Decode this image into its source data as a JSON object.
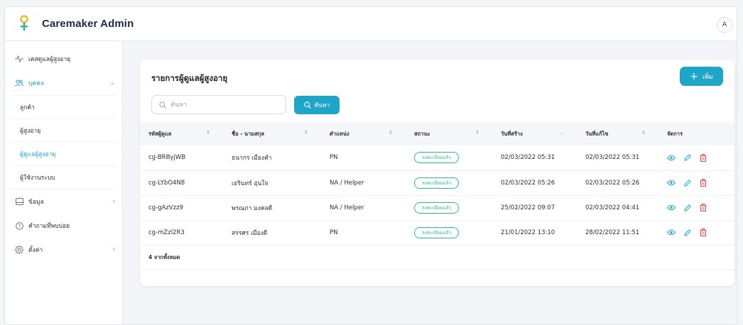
{
  "app": {
    "brand": "Caremaker Admin",
    "avatar_initial": "A",
    "accent": "#1ea5c8",
    "danger": "#e5484d",
    "success": "#2bbf8a"
  },
  "sidebar": {
    "items": [
      {
        "label": "เคสดูแลผู้สูงอายุ",
        "icon": "activity-icon"
      },
      {
        "label": "บุคคล",
        "icon": "users-icon",
        "expanded": true,
        "active": true
      },
      {
        "label": "ข้อมูล",
        "icon": "database-icon"
      },
      {
        "label": "คำถามที่พบบ่อย",
        "icon": "help-icon"
      },
      {
        "label": "ตั้งค่า",
        "icon": "settings-icon"
      }
    ],
    "subitems": [
      {
        "label": "ลูกค้า"
      },
      {
        "label": "ผู้สูงอายุ"
      },
      {
        "label": "ผู้ดูแลผู้สูงอายุ",
        "active": true
      },
      {
        "label": "ผู้ใช้งานระบบ"
      }
    ]
  },
  "main": {
    "title": "รายการผู้ดูแลผู้สูงอายุ",
    "add_label": "เพิ่ม",
    "search_placeholder": "ค้นหา",
    "search_button": "ค้นหา",
    "columns": [
      "รหัสผู้ดูแล",
      "ชื่อ - นามสกุล",
      "ตำแหน่ง",
      "สถานะ",
      "วันที่สร้าง",
      "วันที่แก้ไข",
      "จัดการ"
    ],
    "rows": [
      {
        "id": "cg-BRByjWB",
        "name": "ธนากร เมืองคำ",
        "position": "PN",
        "status": "ลงทะเบียนแล้ว",
        "created": "02/03/2022 05:31",
        "updated": "02/03/2022 05:31"
      },
      {
        "id": "cg-LYbO4N8",
        "name": "เธรินทร์ อุ่นใจ",
        "position": "NA / Helper",
        "status": "ลงทะเบียนแล้ว",
        "created": "02/03/2022 05:26",
        "updated": "02/03/2022 05:26"
      },
      {
        "id": "cg-gAzVzz9",
        "name": "พรณภา มงคลดี",
        "position": "NA / Helper",
        "status": "ลงทะเบียนแล้ว",
        "created": "25/02/2022 09:07",
        "updated": "02/03/2022 04:41"
      },
      {
        "id": "cg-mZzl2R3",
        "name": "สรรศร เมืองดี",
        "position": "PN",
        "status": "ลงทะเบียนแล้ว",
        "created": "21/01/2022 13:10",
        "updated": "28/02/2022 11:51"
      }
    ],
    "total_text": "4 จากทั้งหมด"
  }
}
